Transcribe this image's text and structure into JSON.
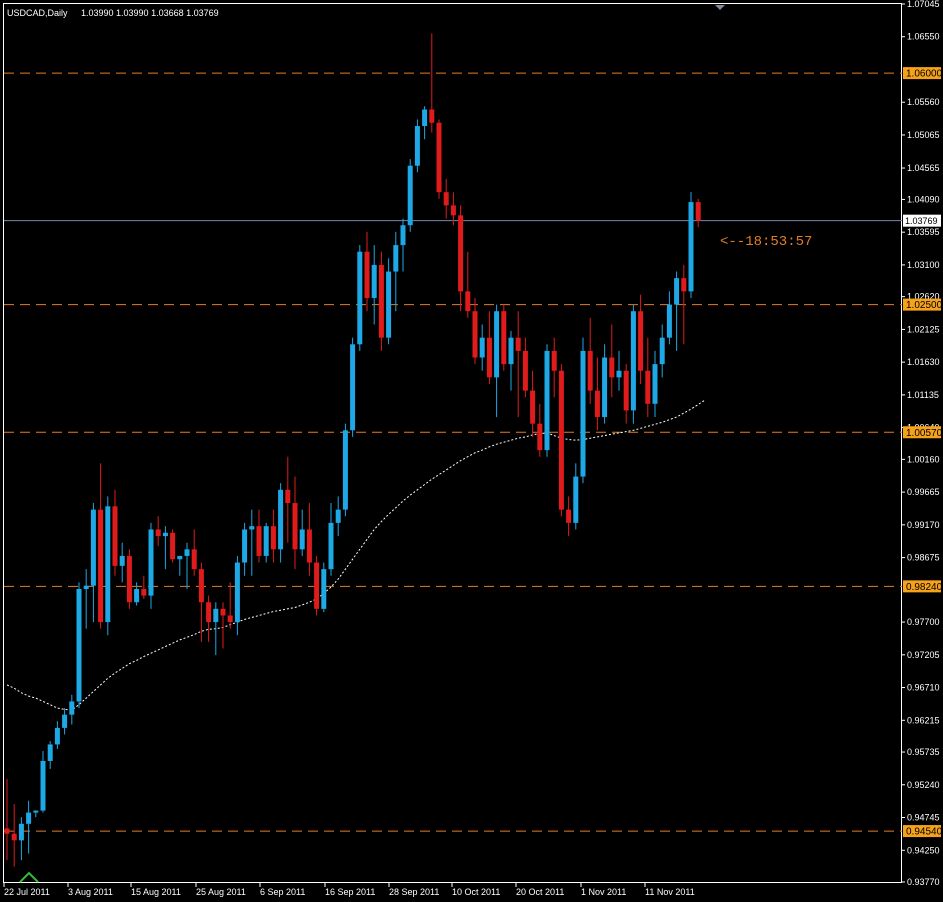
{
  "header": {
    "symbol_timeframe": "USDCAD,Daily",
    "ohlc": "1.03990 1.03990 1.03668 1.03769"
  },
  "countdown": "<--18:53:57",
  "colors": {
    "background": "#000000",
    "frame": "#ffffff",
    "up_candle": "#1ea8e6",
    "down_candle": "#e01b1b",
    "wick": "#ffffff",
    "level_line": "#e27d26",
    "level_box": "#f7a21b",
    "price_line": "#7788aa",
    "moving_average": "#ffffff",
    "countdown": "#e27d26",
    "arrow": "#2fbf2f"
  },
  "chart_data": {
    "type": "candlestick",
    "title": "USDCAD,Daily",
    "price_axis_ticks": [
      "1.07045",
      "1.06550",
      "1.06000",
      "1.05560",
      "1.05065",
      "1.04565",
      "1.04090",
      "1.03769",
      "1.03595",
      "1.03100",
      "1.02620",
      "1.02500",
      "1.02125",
      "1.01630",
      "1.01135",
      "1.00640",
      "1.00570",
      "1.00160",
      "0.99665",
      "0.99170",
      "0.98675",
      "0.98240",
      "0.97700",
      "0.97205",
      "0.96710",
      "0.96215",
      "0.95735",
      "0.95240",
      "0.94745",
      "0.94540",
      "0.94250",
      "0.93770"
    ],
    "time_axis_ticks": [
      "22 Jul 2011",
      "3 Aug 2011",
      "15 Aug 2011",
      "25 Aug 2011",
      "6 Sep 2011",
      "16 Sep 2011",
      "28 Sep 2011",
      "10 Oct 2011",
      "20 Oct 2011",
      "1 Nov 2011",
      "11 Nov 2011"
    ],
    "horizontal_levels": [
      "1.0600",
      "1.0250",
      "1.0057",
      "0.9824",
      "0.9454"
    ],
    "current_price": "1.03769",
    "ylim": [
      0.9377,
      1.07045
    ],
    "candles": [
      [
        0.9458,
        0.9533,
        0.941,
        0.945
      ],
      [
        0.945,
        0.9495,
        0.94,
        0.944
      ],
      [
        0.944,
        0.9475,
        0.941,
        0.9465
      ],
      [
        0.9465,
        0.95,
        0.942,
        0.9482
      ],
      [
        0.9482,
        0.9485,
        0.9475,
        0.9485
      ],
      [
        0.9485,
        0.9575,
        0.9482,
        0.956
      ],
      [
        0.956,
        0.959,
        0.9548,
        0.9585
      ],
      [
        0.9585,
        0.962,
        0.9578,
        0.961
      ],
      [
        0.961,
        0.964,
        0.96,
        0.963
      ],
      [
        0.963,
        0.966,
        0.9615,
        0.965
      ],
      [
        0.965,
        0.983,
        0.964,
        0.982
      ],
      [
        0.982,
        0.985,
        0.976,
        0.9825
      ],
      [
        0.9825,
        0.995,
        0.977,
        0.994
      ],
      [
        0.994,
        1.001,
        0.976,
        0.977
      ],
      [
        0.977,
        0.996,
        0.975,
        0.9945
      ],
      [
        0.9945,
        0.997,
        0.984,
        0.9855
      ],
      [
        0.9855,
        0.989,
        0.983,
        0.987
      ],
      [
        0.987,
        0.988,
        0.979,
        0.98
      ],
      [
        0.98,
        0.983,
        0.9795,
        0.982
      ],
      [
        0.982,
        0.984,
        0.9805,
        0.981
      ],
      [
        0.981,
        0.992,
        0.979,
        0.991
      ],
      [
        0.991,
        0.993,
        0.9885,
        0.99
      ],
      [
        0.99,
        0.9915,
        0.985,
        0.9905
      ],
      [
        0.9905,
        0.991,
        0.986,
        0.9865
      ],
      [
        0.9865,
        0.987,
        0.984,
        0.987
      ],
      [
        0.987,
        0.989,
        0.982,
        0.988
      ],
      [
        0.988,
        0.991,
        0.984,
        0.985
      ],
      [
        0.985,
        0.986,
        0.974,
        0.98
      ],
      [
        0.98,
        0.981,
        0.974,
        0.977
      ],
      [
        0.977,
        0.98,
        0.972,
        0.979
      ],
      [
        0.979,
        0.98,
        0.973,
        0.978
      ],
      [
        0.978,
        0.983,
        0.976,
        0.977
      ],
      [
        0.977,
        0.987,
        0.975,
        0.986
      ],
      [
        0.986,
        0.992,
        0.984,
        0.991
      ],
      [
        0.991,
        0.994,
        0.984,
        0.9915
      ],
      [
        0.9915,
        0.994,
        0.986,
        0.987
      ],
      [
        0.987,
        0.992,
        0.986,
        0.9915
      ],
      [
        0.9915,
        0.994,
        0.986,
        0.988
      ],
      [
        0.988,
        0.998,
        0.986,
        0.997
      ],
      [
        0.997,
        1.002,
        0.989,
        0.995
      ],
      [
        0.995,
        0.999,
        0.985,
        0.988
      ],
      [
        0.988,
        0.994,
        0.987,
        0.991
      ],
      [
        0.991,
        0.995,
        0.984,
        0.986
      ],
      [
        0.986,
        0.987,
        0.978,
        0.979
      ],
      [
        0.979,
        0.986,
        0.9785,
        0.985
      ],
      [
        0.985,
        0.995,
        0.984,
        0.992
      ],
      [
        0.992,
        0.996,
        0.99,
        0.994
      ],
      [
        0.994,
        1.007,
        0.993,
        1.006
      ],
      [
        1.006,
        1.02,
        1.005,
        1.019
      ],
      [
        1.019,
        1.034,
        1.018,
        1.033
      ],
      [
        1.033,
        1.036,
        1.024,
        1.026
      ],
      [
        1.026,
        1.034,
        1.022,
        1.031
      ],
      [
        1.031,
        1.033,
        1.018,
        1.02
      ],
      [
        1.02,
        1.032,
        1.019,
        1.03
      ],
      [
        1.03,
        1.036,
        1.024,
        1.034
      ],
      [
        1.034,
        1.038,
        1.03,
        1.037
      ],
      [
        1.037,
        1.047,
        1.036,
        1.046
      ],
      [
        1.046,
        1.053,
        1.045,
        1.052
      ],
      [
        1.052,
        1.055,
        1.05,
        1.0545
      ],
      [
        1.0545,
        1.066,
        1.051,
        1.0525
      ],
      [
        1.0525,
        1.053,
        1.041,
        1.042
      ],
      [
        1.042,
        1.044,
        1.038,
        1.04
      ],
      [
        1.04,
        1.042,
        1.037,
        1.0385
      ],
      [
        1.0385,
        1.04,
        1.024,
        1.027
      ],
      [
        1.027,
        1.033,
        1.023,
        1.024
      ],
      [
        1.024,
        1.026,
        1.016,
        1.017
      ],
      [
        1.017,
        1.022,
        1.015,
        1.02
      ],
      [
        1.02,
        1.024,
        1.013,
        1.014
      ],
      [
        1.014,
        1.025,
        1.008,
        1.024
      ],
      [
        1.024,
        1.025,
        1.015,
        1.016
      ],
      [
        1.016,
        1.021,
        1.012,
        1.02
      ],
      [
        1.02,
        1.024,
        1.008,
        1.018
      ],
      [
        1.018,
        1.02,
        1.011,
        1.012
      ],
      [
        1.012,
        1.015,
        1.005,
        1.007
      ],
      [
        1.007,
        1.01,
        1.002,
        1.003
      ],
      [
        1.003,
        1.019,
        1.002,
        1.018
      ],
      [
        1.018,
        1.02,
        1.011,
        1.015
      ],
      [
        1.015,
        1.016,
        0.993,
        0.994
      ],
      [
        0.994,
        0.996,
        0.99,
        0.992
      ],
      [
        0.992,
        1.001,
        0.991,
        0.999
      ],
      [
        0.999,
        1.02,
        0.998,
        1.018
      ],
      [
        1.018,
        1.023,
        1.01,
        1.012
      ],
      [
        1.012,
        1.017,
        1.006,
        1.008
      ],
      [
        1.008,
        1.019,
        1.007,
        1.017
      ],
      [
        1.017,
        1.022,
        1.011,
        1.014
      ],
      [
        1.014,
        1.018,
        1.012,
        1.015
      ],
      [
        1.015,
        1.016,
        1.007,
        1.009
      ],
      [
        1.009,
        1.025,
        1.007,
        1.024
      ],
      [
        1.024,
        1.0265,
        1.013,
        1.015
      ],
      [
        1.015,
        1.02,
        1.008,
        1.01
      ],
      [
        1.01,
        1.018,
        1.008,
        1.016
      ],
      [
        1.016,
        1.022,
        1.014,
        1.02
      ],
      [
        1.02,
        1.027,
        1.019,
        1.025
      ],
      [
        1.025,
        1.03,
        1.018,
        1.029
      ],
      [
        1.029,
        1.031,
        1.019,
        1.027
      ],
      [
        1.027,
        1.042,
        1.026,
        1.0405
      ],
      [
        1.0405,
        1.041,
        1.0367,
        1.0377
      ]
    ],
    "moving_average": [
      0.9675,
      0.967,
      0.9663,
      0.9658,
      0.9655,
      0.965,
      0.9645,
      0.964,
      0.9638,
      0.9637,
      0.9645,
      0.9655,
      0.9665,
      0.9675,
      0.9685,
      0.9693,
      0.97,
      0.9707,
      0.9712,
      0.9718,
      0.9723,
      0.9728,
      0.9733,
      0.9738,
      0.9743,
      0.9747,
      0.9751,
      0.9756,
      0.9759,
      0.976,
      0.9762,
      0.9766,
      0.977,
      0.9774,
      0.9777,
      0.978,
      0.9783,
      0.9786,
      0.9788,
      0.979,
      0.9792,
      0.9796,
      0.98,
      0.9805,
      0.9813,
      0.9823,
      0.9835,
      0.985,
      0.9865,
      0.988,
      0.9895,
      0.991,
      0.9922,
      0.9933,
      0.9943,
      0.9953,
      0.9962,
      0.997,
      0.9978,
      0.9986,
      0.9993,
      1.0,
      1.0007,
      1.0014,
      1.002,
      1.0026,
      1.003,
      1.0035,
      1.0039,
      1.0042,
      1.0045,
      1.0048,
      1.005,
      1.0053,
      1.0055,
      1.0056,
      1.0052,
      1.0048,
      1.0046,
      1.0045,
      1.0046,
      1.0048,
      1.005,
      1.0052,
      1.0054,
      1.0056,
      1.0058,
      1.006,
      1.0063,
      1.0066,
      1.0069,
      1.0072,
      1.0076,
      1.008,
      1.0086,
      1.0092,
      1.0099,
      1.0106
    ]
  }
}
